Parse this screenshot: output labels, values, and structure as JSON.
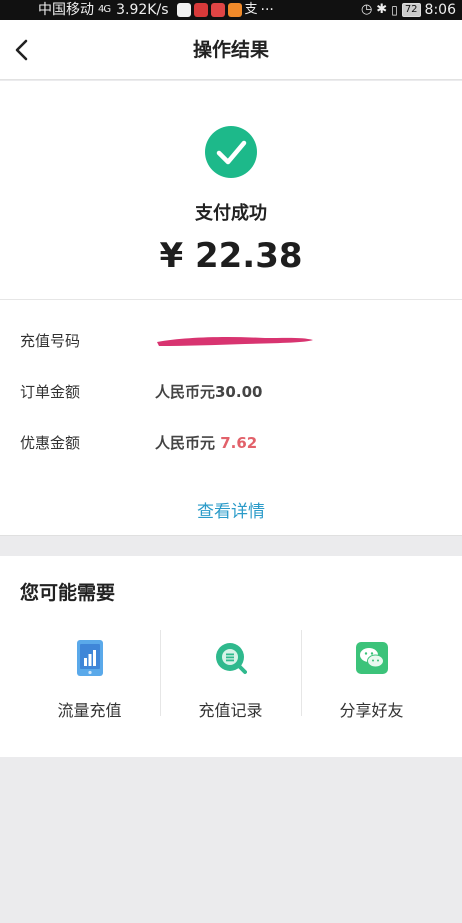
{
  "status_bar": {
    "carrier": "中国移动",
    "signal": "4G",
    "speed": "3.92K/s",
    "ellipsis": "···",
    "battery": "72",
    "time": "8:06"
  },
  "navbar": {
    "back_icon": "chevron-left-icon",
    "title": "操作结果"
  },
  "result": {
    "icon": "check-circle-icon",
    "icon_color": "#1db98a",
    "status": "支付成功",
    "amount": "¥ 22.38"
  },
  "details": {
    "rows": [
      {
        "label": "充值号码",
        "value": ""
      },
      {
        "label": "订单金额",
        "value": "人民币元30.00"
      },
      {
        "label": "优惠金额",
        "value_prefix": "人民币元 ",
        "value_highlight": "7.62"
      }
    ],
    "highlight_color": "#e2616a",
    "link": "查看详情",
    "link_color": "#2b9bc9"
  },
  "recommend": {
    "title": "您可能需要",
    "items": [
      {
        "label": "流量充值",
        "icon": "data-plan-phone-icon"
      },
      {
        "label": "充值记录",
        "icon": "records-search-icon"
      },
      {
        "label": "分享好友",
        "icon": "wechat-share-icon"
      }
    ]
  }
}
